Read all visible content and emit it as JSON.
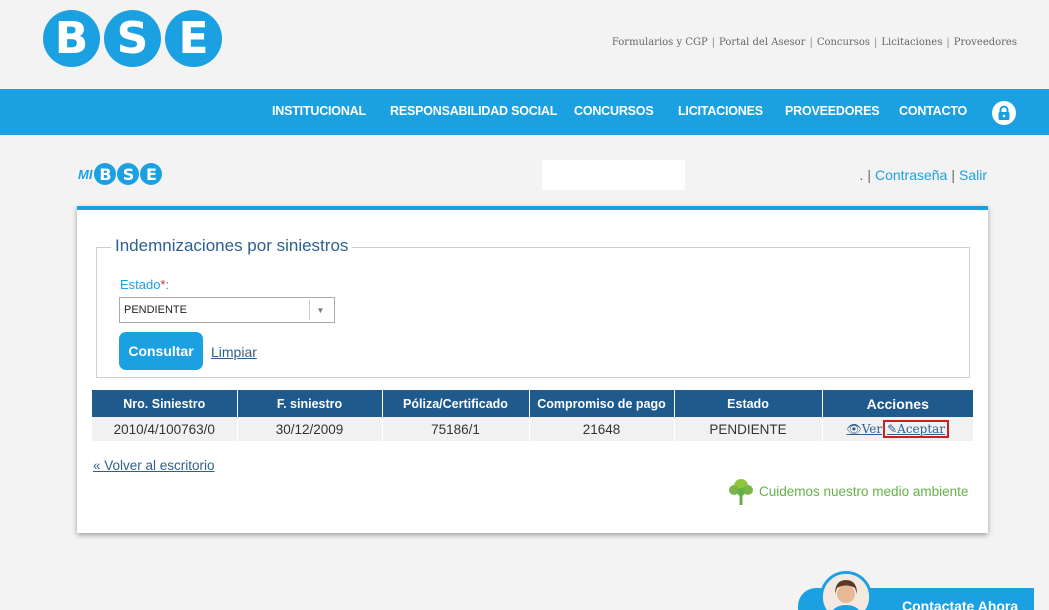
{
  "header": {
    "logo_letters": [
      "B",
      "S",
      "E"
    ],
    "top_links": [
      "Formularios y CGP",
      "Portal del Asesor",
      "Concursos",
      "Licitaciones",
      "Proveedores"
    ]
  },
  "nav": {
    "items": [
      "INSTITUCIONAL",
      "RESPONSABILIDAD SOCIAL",
      "CONCURSOS",
      "LICITACIONES",
      "PROVEEDORES",
      "CONTACTO"
    ]
  },
  "mibse": {
    "mi": "MI",
    "letters": [
      "B",
      "S",
      "E"
    ]
  },
  "account": {
    "prefix": ".",
    "password_link": "Contraseña",
    "logout_link": "Salir"
  },
  "form": {
    "legend": "Indemnizaciones por siniestros",
    "estado_label": "Estado",
    "required_mark": "*",
    "estado_suffix": ":",
    "estado_value": "PENDIENTE",
    "consultar": "Consultar",
    "limpiar": "Limpiar"
  },
  "table": {
    "headers": [
      "Nro. Siniestro",
      "F. siniestro",
      "Póliza/Certificado",
      "Compromiso de pago",
      "Estado",
      "Acciones"
    ],
    "rows": [
      {
        "nro": "2010/4/100763/0",
        "fecha": "30/12/2009",
        "poliza": "75186/1",
        "compromiso": "21648",
        "estado": "PENDIENTE",
        "ver": "Ver",
        "aceptar": "Aceptar"
      }
    ]
  },
  "footer": {
    "volver": "« Volver al escritorio",
    "eco": "Cuidemos nuestro medio ambiente",
    "contact": "Contactate Ahora"
  },
  "colors": {
    "brand": "#1ba1e2",
    "table_header": "#1e5a8c",
    "highlight": "#cc1f1f",
    "eco": "#66b04a"
  }
}
